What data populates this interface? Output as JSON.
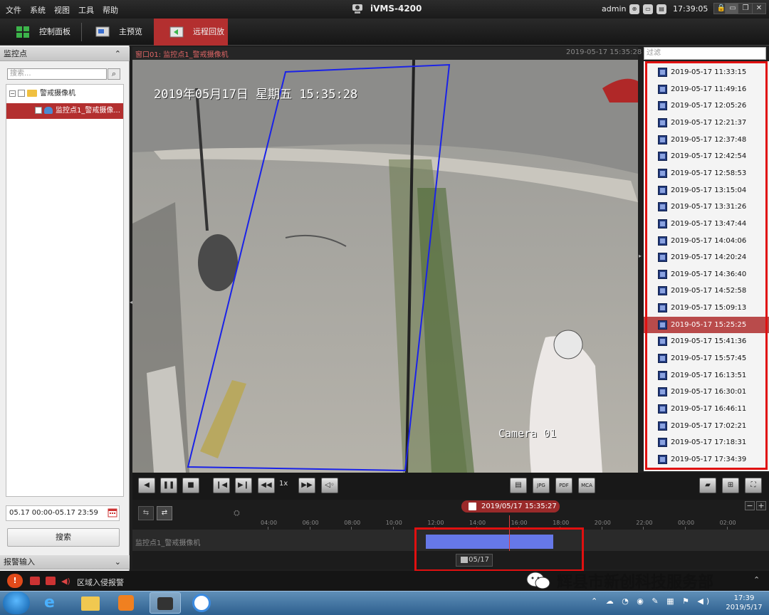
{
  "titlebar": {
    "menus": [
      "文件",
      "系统",
      "视图",
      "工具",
      "帮助"
    ],
    "app_title": "iVMS-4200",
    "user": "admin",
    "clock": "17:39:05"
  },
  "tabs": [
    {
      "label": "控制面板",
      "icon": "control-panel-icon"
    },
    {
      "label": "主预览",
      "icon": "preview-icon"
    },
    {
      "label": "远程回放",
      "icon": "playback-icon",
      "active": true
    }
  ],
  "left_panel": {
    "section_title": "监控点",
    "search_placeholder": "搜索...",
    "tree": {
      "group_label": "警戒摄像机",
      "camera_label": "监控点1_警戒摄像..."
    },
    "date_range": "05.17 00:00-05.17 23:59",
    "search_button": "搜索",
    "alarm_section": "报警输入"
  },
  "video": {
    "window_title": "窗口01: 监控点1_警戒摄像机",
    "window_time": "2019-05-17 15:35:28",
    "osd_datetime": "2019年05月17日 星期五 15:35:28",
    "osd_camera": "Camera 01"
  },
  "controls": {
    "speed": "1x"
  },
  "timeline": {
    "marker": "2019/05/17 15:35:27",
    "ticks": [
      "04:00",
      "06:00",
      "08:00",
      "10:00",
      "12:00",
      "14:00",
      "16:00",
      "18:00",
      "20:00",
      "22:00",
      "00:00",
      "02:00"
    ],
    "track_label": "监控点1_警戒摄像机",
    "date_chip": "05/17"
  },
  "right_panel": {
    "filter_placeholder": "过滤",
    "files": [
      "2019-05-17 11:33:15",
      "2019-05-17 11:49:16",
      "2019-05-17 12:05:26",
      "2019-05-17 12:21:37",
      "2019-05-17 12:37:48",
      "2019-05-17 12:42:54",
      "2019-05-17 12:58:53",
      "2019-05-17 13:15:04",
      "2019-05-17 13:31:26",
      "2019-05-17 13:47:44",
      "2019-05-17 14:04:06",
      "2019-05-17 14:20:24",
      "2019-05-17 14:36:40",
      "2019-05-17 14:52:58",
      "2019-05-17 15:09:13",
      "2019-05-17 15:25:25",
      "2019-05-17 15:41:36",
      "2019-05-17 15:57:45",
      "2019-05-17 16:13:51",
      "2019-05-17 16:30:01",
      "2019-05-17 16:46:11",
      "2019-05-17 17:02:21",
      "2019-05-17 17:18:31",
      "2019-05-17 17:34:39"
    ],
    "selected_index": 15
  },
  "alarm_bar": {
    "text": "区域入侵报警",
    "watermark": "辉县市新创科技服务部"
  },
  "taskbar": {
    "time": "17:39",
    "date": "2019/5/17"
  },
  "colors": {
    "accent_red": "#b32f2f",
    "highlight_box": "#e01010",
    "recording_bar": "#6678e8"
  }
}
